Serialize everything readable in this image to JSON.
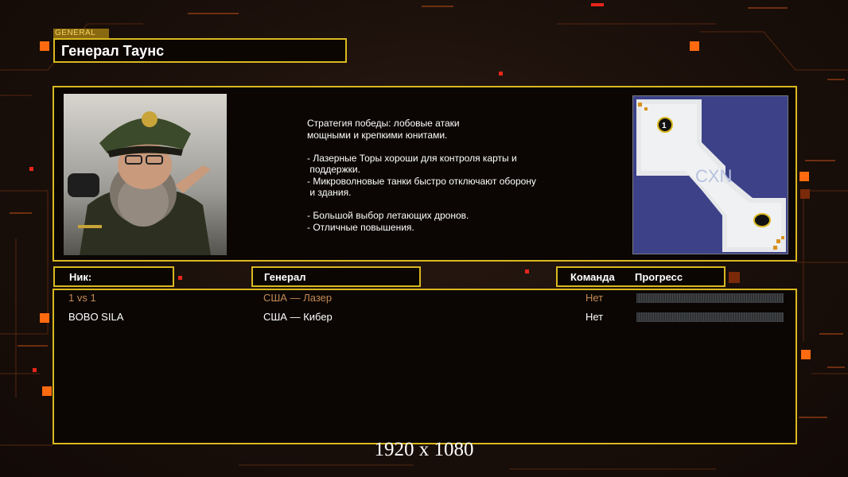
{
  "general": {
    "tag": "GENERAL",
    "name": "Генерал Таунс",
    "description_lines": [
      "Стратегия победы: лобовые атаки",
      "мощными и крепкими юнитами.",
      "",
      "- Лазерные Торы хороши для контроля карты и",
      " поддержки.",
      "- Микроволновые танки быстро отключают оборону",
      " и здания.",
      "",
      "- Большой выбор летающих дронов.",
      "- Отличные повышения."
    ]
  },
  "minimap": {
    "start_marker_1": "1",
    "map_logo": "CXN"
  },
  "columns": {
    "nick": "Ник:",
    "general": "Генерал",
    "team": "Команда",
    "progress": "Прогресс"
  },
  "players": [
    {
      "nick": "1 vs 1",
      "general": "США — Лазер",
      "team": "Нет",
      "progress": 0,
      "is_local": true
    },
    {
      "nick": "BOBO  SILA",
      "general": "США — Кибер",
      "team": "Нет",
      "progress": 0,
      "is_local": false
    }
  ],
  "resolution_label": "1920 x 1080",
  "colors": {
    "frame": "#d9b81f",
    "accent": "#ff6a10",
    "local_player": "#c58a52"
  }
}
